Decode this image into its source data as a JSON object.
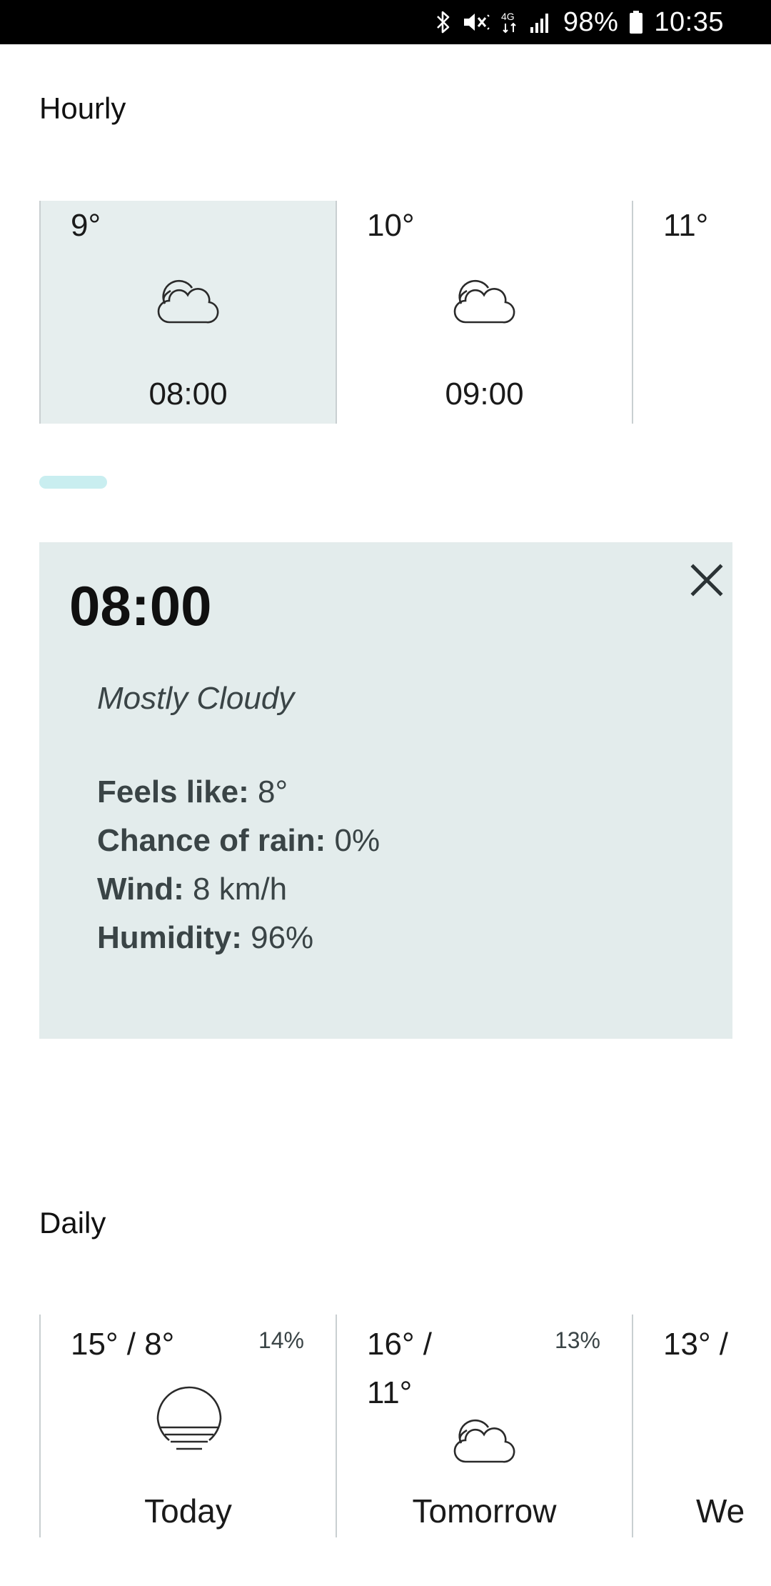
{
  "status_bar": {
    "icons": [
      "bluetooth-icon",
      "mute-icon",
      "4g-icon",
      "signal-icon",
      "battery-icon"
    ],
    "network": "4G",
    "battery": "98%",
    "time": "10:35"
  },
  "hourly": {
    "title": "Hourly",
    "items": [
      {
        "temp": "9°",
        "time": "08:00",
        "icon": "mostly-cloudy-icon",
        "selected": true
      },
      {
        "temp": "10°",
        "time": "09:00",
        "icon": "mostly-cloudy-icon",
        "selected": false
      },
      {
        "temp": "11°",
        "time": "",
        "icon": "",
        "selected": false
      }
    ]
  },
  "detail": {
    "time": "08:00",
    "condition": "Mostly Cloudy",
    "rows": [
      {
        "label": "Feels like:",
        "value": " 8°"
      },
      {
        "label": "Chance of rain:",
        "value": " 0%"
      },
      {
        "label": "Wind:",
        "value": " 8 km/h"
      },
      {
        "label": "Humidity:",
        "value": " 96%"
      }
    ],
    "close_icon": "close-icon"
  },
  "daily": {
    "title": "Daily",
    "items": [
      {
        "range": "15° / 8°",
        "rain": "14%",
        "label": "Today",
        "icon": "hazy-sun-icon"
      },
      {
        "range": "16° / 11°",
        "rain": "13%",
        "label": "Tomorrow",
        "icon": "mostly-cloudy-icon"
      },
      {
        "range": "13° /",
        "rain": "",
        "label": "We",
        "icon": ""
      }
    ]
  },
  "colors": {
    "selected_card_bg": "#e6eeee",
    "detail_panel_bg": "#e3ecec",
    "scroll_indicator": "#c9eef0",
    "divider": "#c9cfd1"
  }
}
